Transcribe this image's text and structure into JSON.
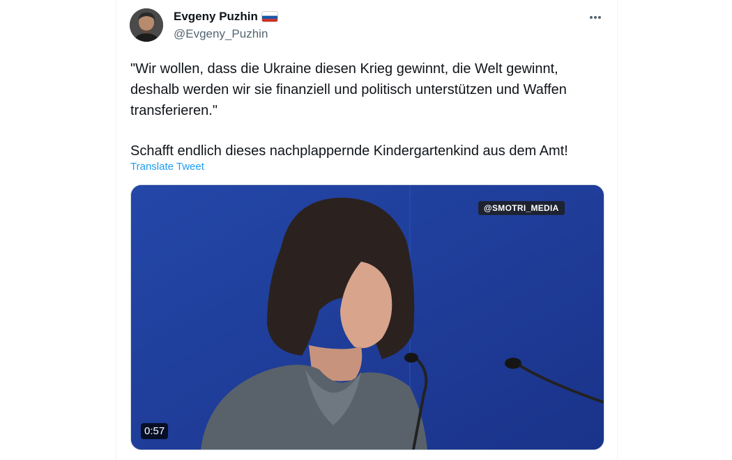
{
  "author": {
    "name": "Evgeny Puzhin",
    "handle": "@Evgeny_Puzhin",
    "flag_icon": "russia-flag-icon"
  },
  "tweet": {
    "paragraphs": [
      "\"Wir wollen, dass die Ukraine diesen Krieg gewinnt, die Welt gewinnt,\ndeshalb werden wir sie finanziell und politisch unterstützen und Waffen\ntransferieren.\"",
      "Schafft endlich dieses nachplappernde Kindergartenkind aus dem Amt!"
    ],
    "translate_label": "Translate Tweet"
  },
  "media": {
    "watermark": "@SMOTRI_MEDIA",
    "duration": "0:57"
  },
  "colors": {
    "link": "#1d9bf0",
    "text": "#0f1419",
    "secondary": "#536471",
    "video_background": "#1d3c9a"
  }
}
